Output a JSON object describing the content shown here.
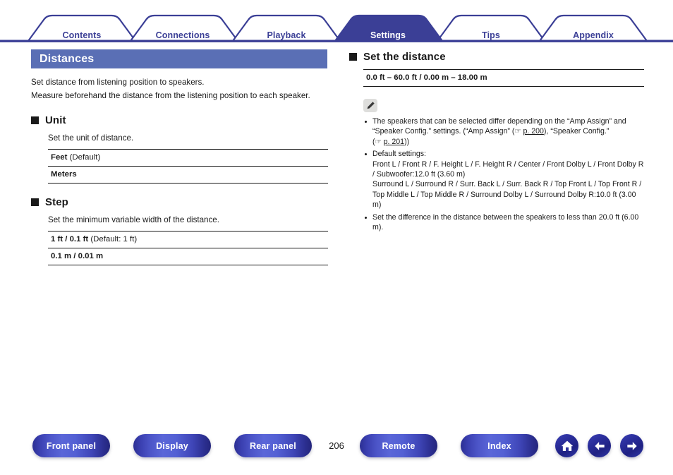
{
  "tabs": [
    {
      "label": "Contents",
      "active": false
    },
    {
      "label": "Connections",
      "active": false
    },
    {
      "label": "Playback",
      "active": false
    },
    {
      "label": "Settings",
      "active": true
    },
    {
      "label": "Tips",
      "active": false
    },
    {
      "label": "Appendix",
      "active": false
    }
  ],
  "colors": {
    "tab_blue": "#3b3f96",
    "title_bar": "#5a6fb5",
    "button_blue": "#2c2f93",
    "text": "#1a1a1a"
  },
  "page": {
    "title": "Distances",
    "intro_line1": "Set distance from listening position to speakers.",
    "intro_line2": "Measure beforehand the distance from the listening position to each speaker."
  },
  "left": {
    "sections": [
      {
        "heading": "Unit",
        "description": "Set the unit of distance.",
        "options": [
          {
            "bold": "Feet",
            "normal": " (Default)"
          },
          {
            "bold": "Meters",
            "normal": ""
          }
        ]
      },
      {
        "heading": "Step",
        "description": "Set the minimum variable width of the distance.",
        "options": [
          {
            "bold": "1 ft / 0.1 ft",
            "normal": " (Default: 1 ft)"
          },
          {
            "bold": "0.1 m / 0.01 m",
            "normal": ""
          }
        ]
      }
    ]
  },
  "right": {
    "heading": "Set the distance",
    "range": "0.0 ft – 60.0 ft / 0.00 m – 18.00 m",
    "note_icon": "pencil-icon",
    "notes": {
      "note1_a": "The speakers that can be selected differ depending on the “Amp Assign” and “Speaker Config.” settings. (“Amp Assign” (",
      "note1_link1": "p. 200",
      "note1_b": "), “Speaker Config.” (",
      "note1_link2": "p. 201",
      "note1_c": "))",
      "note2_title": "Default settings:",
      "note2_line1": "Front L / Front R / F. Height L / F. Height R / Center / Front Dolby L / Front Dolby R / Subwoofer:12.0 ft (3.60 m)",
      "note2_line2": "Surround L / Surround R / Surr. Back L / Surr. Back R / Top Front L / Top Front R / Top Middle L / Top Middle R / Surround Dolby L / Surround Dolby R:10.0 ft (3.00 m)",
      "note3": "Set the difference in the distance between the speakers to less than 20.0 ft (6.00 m)."
    }
  },
  "footer": {
    "buttons": [
      {
        "label": "Front panel"
      },
      {
        "label": "Display"
      },
      {
        "label": "Rear panel"
      },
      {
        "label": "Remote"
      },
      {
        "label": "Index"
      }
    ],
    "page_number": "206",
    "icons": [
      {
        "name": "home-icon"
      },
      {
        "name": "arrow-left-icon"
      },
      {
        "name": "arrow-right-icon"
      }
    ]
  }
}
